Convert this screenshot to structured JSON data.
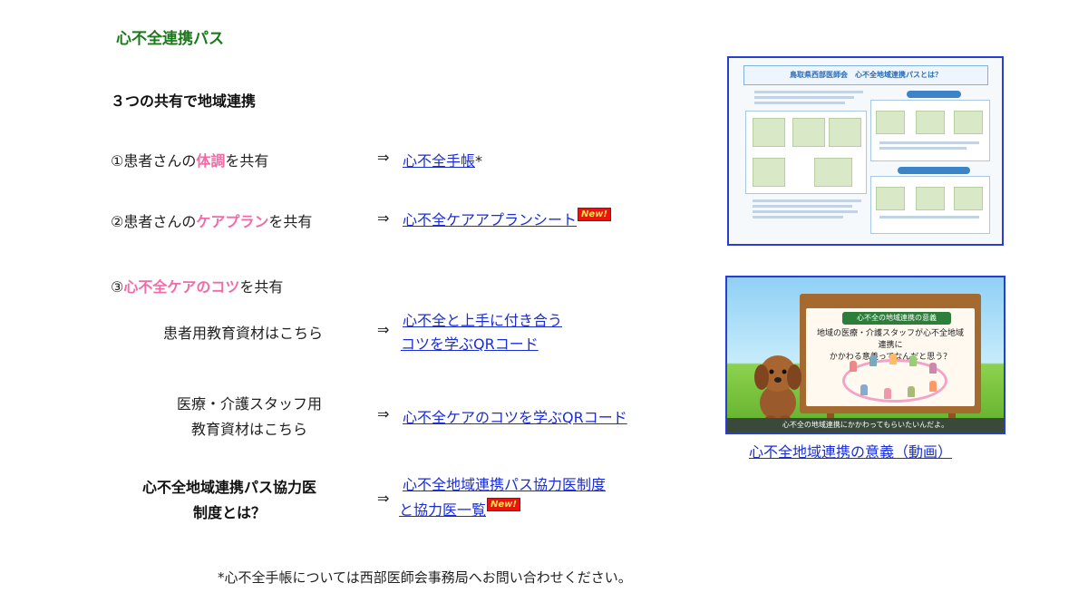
{
  "title": "心不全連携パス",
  "subtitle": "３つの共有で地域連携",
  "arrow": "⇒",
  "row1": {
    "prefix": "①患者さんの",
    "highlight": "体調",
    "suffix": "を共有",
    "link": "心不全手帳",
    "after": "*"
  },
  "row2": {
    "prefix": "②患者さんの",
    "highlight": "ケアプラン",
    "suffix": "を共有",
    "link": "心不全ケアアプランシート",
    "badge": "New!"
  },
  "row3": {
    "prefix": "③",
    "highlight": "心不全ケアのコツ",
    "suffix": "を共有"
  },
  "row4": {
    "label": "患者用教育資材はこちら",
    "link_line1": "心不全と上手に付き合う",
    "link_line2": "コツを学ぶQRコード"
  },
  "row5": {
    "label_line1": "医療・介護スタッフ用",
    "label_line2": "教育資材はこちら",
    "link": "心不全ケアのコツを学ぶQRコード"
  },
  "row6": {
    "label_line1": "心不全地域連携パス協力医",
    "label_line2": "制度とは？",
    "link_line1": "心不全地域連携パス協力医制度",
    "link_line2": "と協力医一覧",
    "badge": "New!"
  },
  "footnote": "*心不全手帳については西部医師会事務局へお問い合わせください。",
  "leaflet": {
    "heading": "鳥取県西部医師会　心不全地域連携パスとは？"
  },
  "video": {
    "board_title": "心不全の地域連携の意義",
    "board_text_1": "地域の医療・介護スタッフが心不全地域連携に",
    "board_text_2": "かかわる意義ってなんだと思う？",
    "caption": "心不全の地域連携にかかわってもらいたいんだよ。",
    "link": "心不全地域連携の意義（動画）"
  },
  "colors": {
    "title": "#1a7a1a",
    "highlight": "#f36aa6",
    "link": "#1a2dd6",
    "frame": "#2a3bd6",
    "badge": "#e11111"
  }
}
